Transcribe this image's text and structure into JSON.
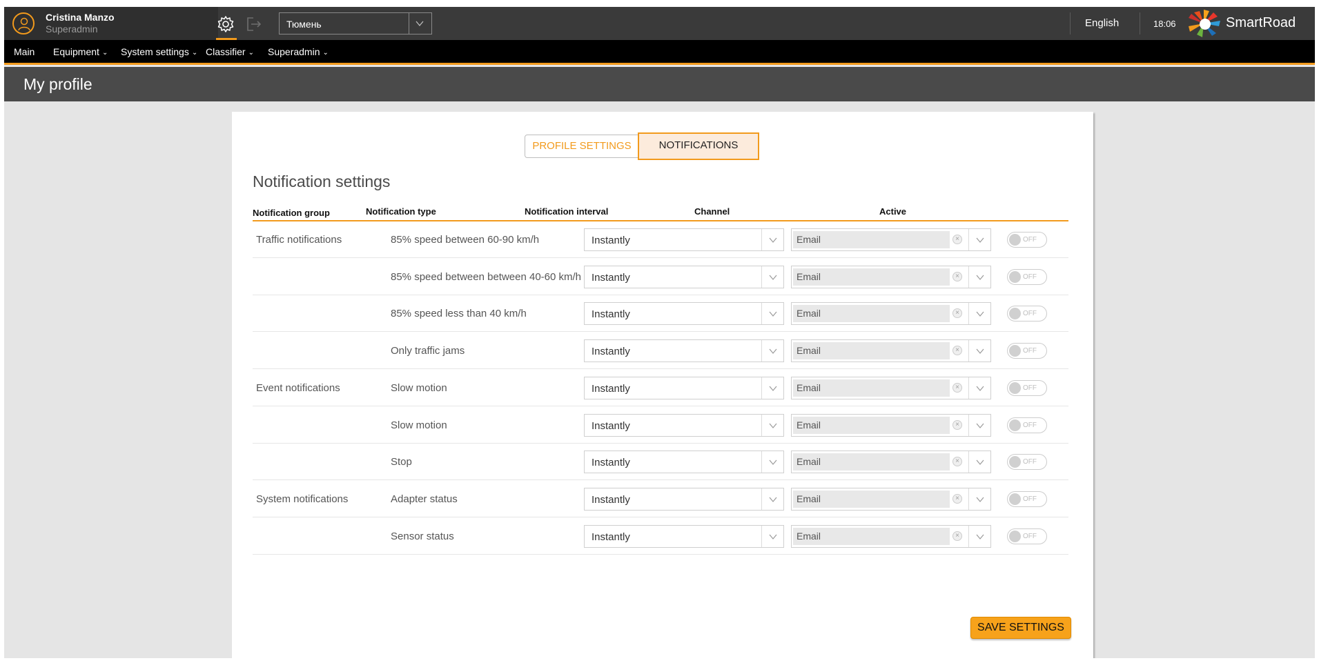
{
  "user": {
    "name": "Cristina Manzo",
    "role": "Superadmin"
  },
  "toolbar": {
    "city": "Тюмень"
  },
  "header": {
    "language": "English",
    "time": "18:06",
    "brand": "SmartRoad"
  },
  "nav": [
    {
      "label": "Main"
    },
    {
      "label": "Equipment"
    },
    {
      "label": "System settings"
    },
    {
      "label": "Classifier"
    },
    {
      "label": "Superadmin"
    }
  ],
  "page": {
    "title": "My profile"
  },
  "tabs": [
    {
      "label": "PROFILE SETTINGS",
      "active": false
    },
    {
      "label": "NOTIFICATIONS",
      "active": true
    }
  ],
  "section": {
    "title": "Notification settings"
  },
  "table": {
    "columns": [
      "Notification group",
      "Notification type",
      "Notification interval",
      "Channel",
      "Active"
    ],
    "rows": [
      {
        "group": "Traffic notifications",
        "type": "85% speed between 60-90 km/h",
        "interval": "Instantly",
        "channel": "Email",
        "active": "OFF"
      },
      {
        "group": "",
        "type": "85% speed between between 40-60 km/h",
        "interval": "Instantly",
        "channel": "Email",
        "active": "OFF"
      },
      {
        "group": "",
        "type": "85% speed less than 40 km/h",
        "interval": "Instantly",
        "channel": "Email",
        "active": "OFF"
      },
      {
        "group": "",
        "type": "Only traffic jams",
        "interval": "Instantly",
        "channel": "Email",
        "active": "OFF"
      },
      {
        "group": "Event notifications",
        "type": "Slow motion",
        "interval": "Instantly",
        "channel": "Email",
        "active": "OFF"
      },
      {
        "group": "",
        "type": "Slow motion",
        "interval": "Instantly",
        "channel": "Email",
        "active": "OFF"
      },
      {
        "group": "",
        "type": "Stop",
        "interval": "Instantly",
        "channel": "Email",
        "active": "OFF"
      },
      {
        "group": "System notifications",
        "type": "Adapter status",
        "interval": "Instantly",
        "channel": "Email",
        "active": "OFF"
      },
      {
        "group": "",
        "type": "Sensor status",
        "interval": "Instantly",
        "channel": "Email",
        "active": "OFF"
      }
    ]
  },
  "actions": {
    "save_label": "SAVE SETTINGS"
  },
  "colors": {
    "accent": "#f29a1c",
    "topbar": "#3a3a3a",
    "navbar": "#000000",
    "page_header": "#4a4a4a",
    "background": "#e5e5e5"
  },
  "icons": {
    "avatar": "user-icon",
    "settings": "gear-icon",
    "logout": "logout-icon",
    "dropdown": "chevron-down-icon",
    "clear": "clear-x-icon"
  }
}
